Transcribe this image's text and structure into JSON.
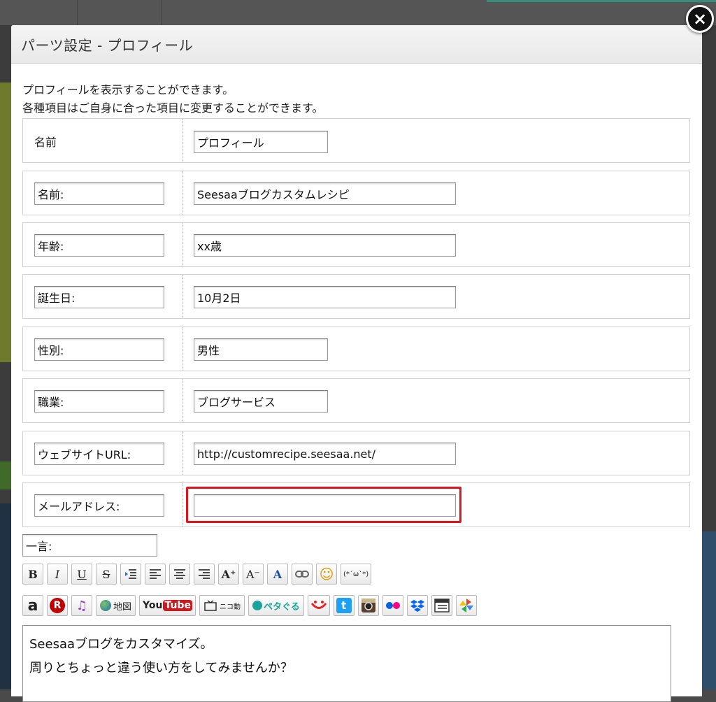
{
  "dialog": {
    "title": "パーツ設定 - プロフィール",
    "close_label": "×",
    "description_line1": "プロフィールを表示することができます。",
    "description_line2": "各種項目はご自身に合った項目に変更することができます。"
  },
  "rows": {
    "name": {
      "label": "名前",
      "value": "プロフィール"
    },
    "row1": {
      "label": "名前:",
      "value": "Seesaaブログカスタムレシピ"
    },
    "row2": {
      "label": "年齢:",
      "value": "xx歳"
    },
    "row3": {
      "label": "誕生日:",
      "value": "10月2日"
    },
    "row4": {
      "label": "性別:",
      "value": "男性"
    },
    "row5": {
      "label": "職業:",
      "value": "ブログサービス"
    },
    "row6": {
      "label": "ウェブサイトURL:",
      "value": "http://customrecipe.seesaa.net/"
    },
    "row7": {
      "label": "メールアドレス:",
      "value": ""
    }
  },
  "comment": {
    "label": "一言:",
    "text_line1": "Seesaaブログをカスタマイズ。",
    "text_line2": "周りとちょっと違う使い方をしてみませんか？"
  },
  "toolbar1": {
    "bold": "B",
    "italic": "I",
    "underline": "U",
    "strike": "S",
    "indent": "indent-icon",
    "align_left": "align-left-icon",
    "align_center": "align-center-icon",
    "align_right": "align-right-icon",
    "font_up": "A⁺",
    "font_down": "A⁻",
    "font_color": "A",
    "link": "link-icon",
    "emoji": "☺",
    "kaomoji": "(*´ω`*)"
  },
  "toolbar2": {
    "amazon": "a",
    "rakuten": "R",
    "music": "♫",
    "map": "地図",
    "youtube_you": "You",
    "youtube_tube": "Tube",
    "nico": "ニコ動",
    "petaguru": "ペタぐる",
    "twitter": "t"
  },
  "colors": {
    "highlight": "#e0151b",
    "rakuten": "#bf0000",
    "youtube": "#cc181e",
    "twitter": "#1da1f2",
    "dropbox": "#0061fe"
  }
}
